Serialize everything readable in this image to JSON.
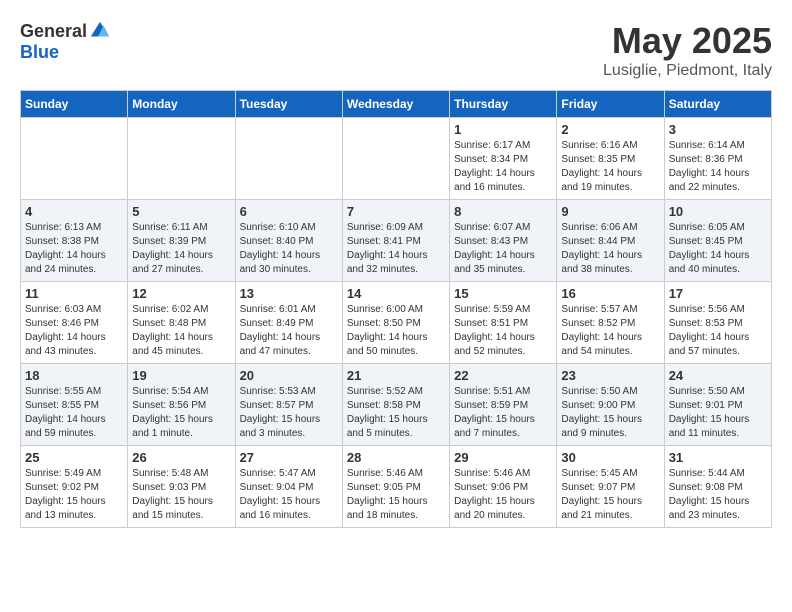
{
  "header": {
    "logo": {
      "general": "General",
      "blue": "Blue"
    },
    "title": "May 2025",
    "location": "Lusiglie, Piedmont, Italy"
  },
  "days_of_week": [
    "Sunday",
    "Monday",
    "Tuesday",
    "Wednesday",
    "Thursday",
    "Friday",
    "Saturday"
  ],
  "weeks": [
    [
      {
        "day": "",
        "info": ""
      },
      {
        "day": "",
        "info": ""
      },
      {
        "day": "",
        "info": ""
      },
      {
        "day": "",
        "info": ""
      },
      {
        "day": "1",
        "sunrise": "6:17 AM",
        "sunset": "8:34 PM",
        "daylight": "14 hours and 16 minutes."
      },
      {
        "day": "2",
        "sunrise": "6:16 AM",
        "sunset": "8:35 PM",
        "daylight": "14 hours and 19 minutes."
      },
      {
        "day": "3",
        "sunrise": "6:14 AM",
        "sunset": "8:36 PM",
        "daylight": "14 hours and 22 minutes."
      }
    ],
    [
      {
        "day": "4",
        "sunrise": "6:13 AM",
        "sunset": "8:38 PM",
        "daylight": "14 hours and 24 minutes."
      },
      {
        "day": "5",
        "sunrise": "6:11 AM",
        "sunset": "8:39 PM",
        "daylight": "14 hours and 27 minutes."
      },
      {
        "day": "6",
        "sunrise": "6:10 AM",
        "sunset": "8:40 PM",
        "daylight": "14 hours and 30 minutes."
      },
      {
        "day": "7",
        "sunrise": "6:09 AM",
        "sunset": "8:41 PM",
        "daylight": "14 hours and 32 minutes."
      },
      {
        "day": "8",
        "sunrise": "6:07 AM",
        "sunset": "8:43 PM",
        "daylight": "14 hours and 35 minutes."
      },
      {
        "day": "9",
        "sunrise": "6:06 AM",
        "sunset": "8:44 PM",
        "daylight": "14 hours and 38 minutes."
      },
      {
        "day": "10",
        "sunrise": "6:05 AM",
        "sunset": "8:45 PM",
        "daylight": "14 hours and 40 minutes."
      }
    ],
    [
      {
        "day": "11",
        "sunrise": "6:03 AM",
        "sunset": "8:46 PM",
        "daylight": "14 hours and 43 minutes."
      },
      {
        "day": "12",
        "sunrise": "6:02 AM",
        "sunset": "8:48 PM",
        "daylight": "14 hours and 45 minutes."
      },
      {
        "day": "13",
        "sunrise": "6:01 AM",
        "sunset": "8:49 PM",
        "daylight": "14 hours and 47 minutes."
      },
      {
        "day": "14",
        "sunrise": "6:00 AM",
        "sunset": "8:50 PM",
        "daylight": "14 hours and 50 minutes."
      },
      {
        "day": "15",
        "sunrise": "5:59 AM",
        "sunset": "8:51 PM",
        "daylight": "14 hours and 52 minutes."
      },
      {
        "day": "16",
        "sunrise": "5:57 AM",
        "sunset": "8:52 PM",
        "daylight": "14 hours and 54 minutes."
      },
      {
        "day": "17",
        "sunrise": "5:56 AM",
        "sunset": "8:53 PM",
        "daylight": "14 hours and 57 minutes."
      }
    ],
    [
      {
        "day": "18",
        "sunrise": "5:55 AM",
        "sunset": "8:55 PM",
        "daylight": "14 hours and 59 minutes."
      },
      {
        "day": "19",
        "sunrise": "5:54 AM",
        "sunset": "8:56 PM",
        "daylight": "15 hours and 1 minute."
      },
      {
        "day": "20",
        "sunrise": "5:53 AM",
        "sunset": "8:57 PM",
        "daylight": "15 hours and 3 minutes."
      },
      {
        "day": "21",
        "sunrise": "5:52 AM",
        "sunset": "8:58 PM",
        "daylight": "15 hours and 5 minutes."
      },
      {
        "day": "22",
        "sunrise": "5:51 AM",
        "sunset": "8:59 PM",
        "daylight": "15 hours and 7 minutes."
      },
      {
        "day": "23",
        "sunrise": "5:50 AM",
        "sunset": "9:00 PM",
        "daylight": "15 hours and 9 minutes."
      },
      {
        "day": "24",
        "sunrise": "5:50 AM",
        "sunset": "9:01 PM",
        "daylight": "15 hours and 11 minutes."
      }
    ],
    [
      {
        "day": "25",
        "sunrise": "5:49 AM",
        "sunset": "9:02 PM",
        "daylight": "15 hours and 13 minutes."
      },
      {
        "day": "26",
        "sunrise": "5:48 AM",
        "sunset": "9:03 PM",
        "daylight": "15 hours and 15 minutes."
      },
      {
        "day": "27",
        "sunrise": "5:47 AM",
        "sunset": "9:04 PM",
        "daylight": "15 hours and 16 minutes."
      },
      {
        "day": "28",
        "sunrise": "5:46 AM",
        "sunset": "9:05 PM",
        "daylight": "15 hours and 18 minutes."
      },
      {
        "day": "29",
        "sunrise": "5:46 AM",
        "sunset": "9:06 PM",
        "daylight": "15 hours and 20 minutes."
      },
      {
        "day": "30",
        "sunrise": "5:45 AM",
        "sunset": "9:07 PM",
        "daylight": "15 hours and 21 minutes."
      },
      {
        "day": "31",
        "sunrise": "5:44 AM",
        "sunset": "9:08 PM",
        "daylight": "15 hours and 23 minutes."
      }
    ]
  ],
  "labels": {
    "sunrise": "Sunrise:",
    "sunset": "Sunset:",
    "daylight": "Daylight:"
  }
}
